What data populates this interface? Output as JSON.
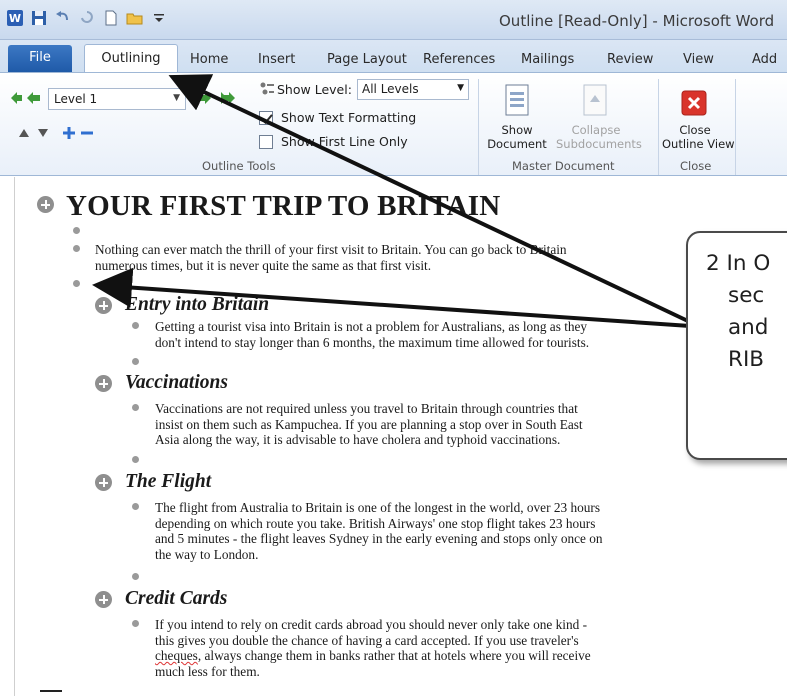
{
  "window": {
    "title": "Outline [Read-Only] - Microsoft Word"
  },
  "tabs": {
    "file": "File",
    "active": "Outlining",
    "items": [
      "Home",
      "Insert",
      "Page Layout",
      "References",
      "Mailings",
      "Review",
      "View",
      "Add"
    ]
  },
  "ribbon": {
    "outline_tools": {
      "level_value": "Level 1",
      "show_level_label": "Show Level:",
      "show_level_value": "All Levels",
      "show_text_formatting": "Show Text Formatting",
      "show_first_line_only": "Show First Line Only",
      "group_label": "Outline Tools"
    },
    "master_document": {
      "show_document": [
        "Show",
        "Document"
      ],
      "collapse_subdocuments": [
        "Collapse",
        "Subdocuments"
      ],
      "group_label": "Master Document"
    },
    "close": {
      "close_outline_view": [
        "Close",
        "Outline View"
      ],
      "group_label": "Close"
    }
  },
  "document": {
    "title": "YOUR FIRST TRIP TO BRITAIN",
    "intro": [
      "Nothing can ever match the thrill of your first visit to Britain. You can go back to Britain",
      "numerous times, but it is never quite the same as that first visit."
    ],
    "sections": [
      {
        "heading": "Entry into Britain",
        "lines": [
          "Getting a tourist visa into Britain is not a problem for Australians, as long as they",
          "don't intend to stay longer than 6 months, the maximum time allowed for tourists."
        ]
      },
      {
        "heading": "Vaccinations",
        "lines": [
          "Vaccinations are not required unless you travel to Britain through countries that",
          "insist on them such as Kampuchea. If you are planning a stop over in South East",
          "Asia along the way, it is advisable to have cholera and typhoid vaccinations."
        ]
      },
      {
        "heading": "The Flight",
        "lines": [
          "The flight from Australia to Britain is one of the longest in the world, over 23 hours",
          "depending on which route you take. British Airways' one stop flight takes 23 hours",
          "and 5 minutes - the flight leaves Sydney in the early evening and stops only once on",
          "the way to London."
        ]
      },
      {
        "heading": "Credit Cards",
        "lines": [
          "If you intend to rely on credit cards abroad you should never only take one kind -",
          "this gives you double the chance of having a card accepted. If you use traveler's",
          "cheques, always change them in banks rather that at hotels where you will receive",
          "much less for them."
        ]
      }
    ]
  },
  "callout": {
    "lines": [
      "2  In O",
      "sec",
      "and",
      "RIB"
    ]
  },
  "colors": {
    "file_tab": "#2a66b6",
    "close_icon": "#d9342b",
    "ribbon_border": "#9fb7d6"
  }
}
